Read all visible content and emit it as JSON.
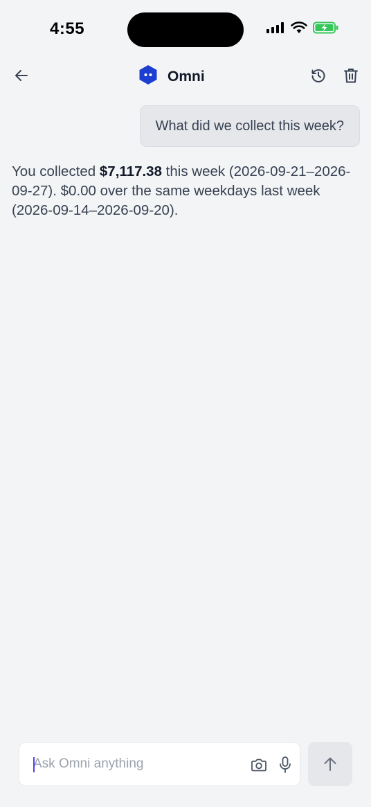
{
  "status_bar": {
    "time": "4:55",
    "icons": [
      "cellular-signal-icon",
      "wifi-icon",
      "battery-charging-icon"
    ],
    "battery_color": "#34c759"
  },
  "header": {
    "title": "Omni",
    "icons": {
      "back": "arrow-left-icon",
      "logo": "omni-hexagon-logo",
      "history": "history-icon",
      "delete": "trash-icon"
    },
    "logo_color": "#1d3fd1"
  },
  "conversation": {
    "user_message": "What did we collect this week?",
    "assistant_message": {
      "before": "You collected ",
      "amount": "$7,117.38",
      "after": " this week (2026-09-21–2026-09-27). $0.00 over the same weekdays last week (2026-09-14–2026-09-20)."
    }
  },
  "composer": {
    "placeholder": "Ask Omni anything",
    "value": "",
    "icons": {
      "camera": "camera-icon",
      "mic": "microphone-icon",
      "send": "arrow-up-icon"
    }
  }
}
